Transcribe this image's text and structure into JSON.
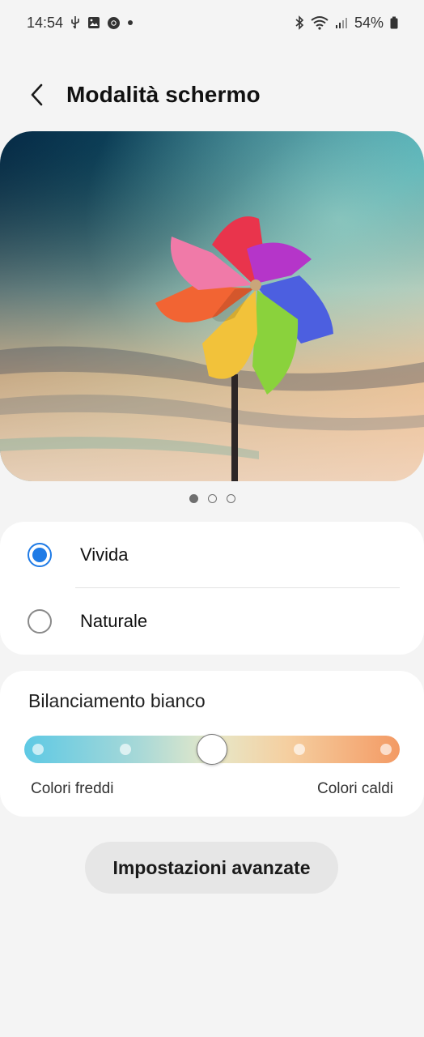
{
  "status_bar": {
    "time": "14:54",
    "left_icons": [
      "usb-icon",
      "gallery-icon",
      "chrome-icon",
      "dot-icon"
    ],
    "right_icons": [
      "bluetooth-icon",
      "wifi-icon",
      "signal-icon",
      "battery-icon"
    ],
    "battery": "54%"
  },
  "header": {
    "back_icon": "chevron-left-icon",
    "title": "Modalità schermo"
  },
  "preview": {
    "description_icon": "pinwheel-image",
    "pages": 3,
    "active_page": 1
  },
  "screen_mode": {
    "options": [
      {
        "label": "Vivida",
        "selected": true
      },
      {
        "label": "Naturale",
        "selected": false
      }
    ]
  },
  "white_balance": {
    "title": "Bilanciamento bianco",
    "left_label": "Colori freddi",
    "right_label": "Colori caldi",
    "steps": 5,
    "value_index": 2
  },
  "advanced_button": {
    "label": "Impostazioni avanzate"
  },
  "colors": {
    "accent": "#1f7be6",
    "background": "#f4f4f4",
    "card": "#ffffff",
    "button": "#e6e6e6"
  }
}
